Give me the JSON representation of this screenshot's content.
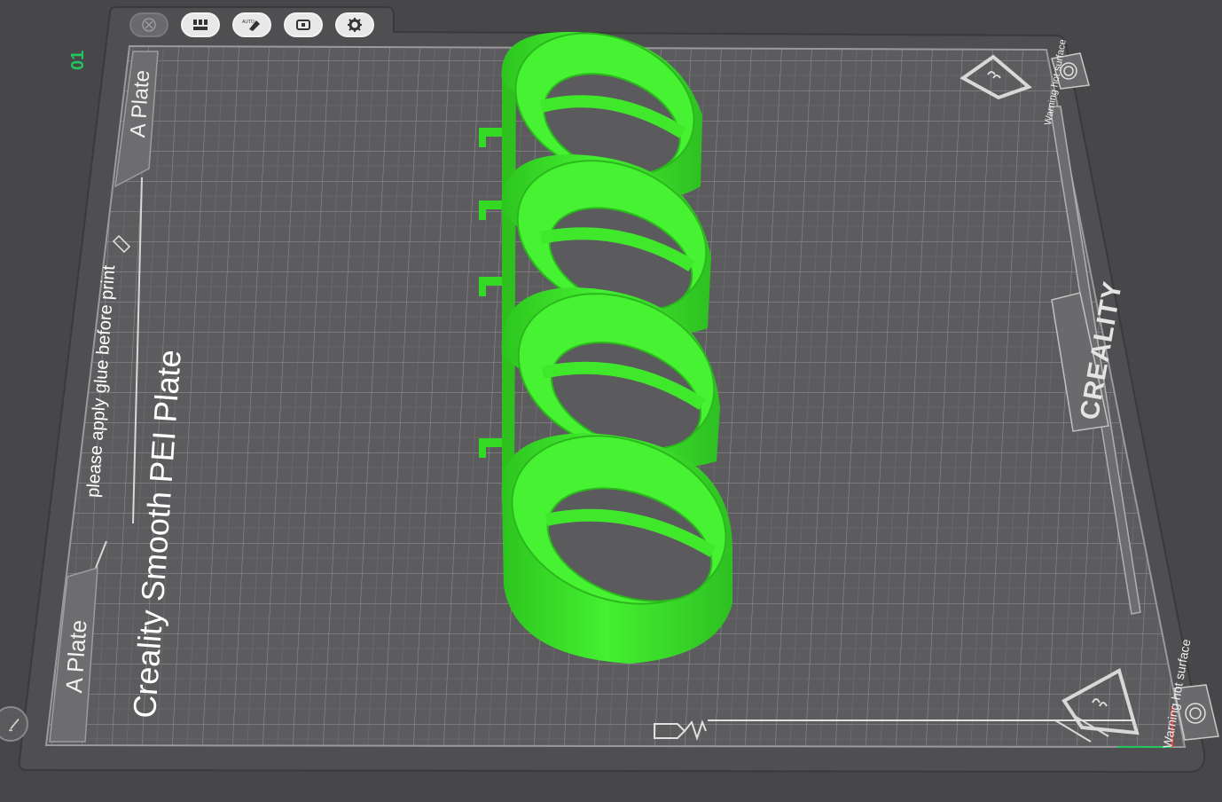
{
  "toolbar": {
    "buttons": [
      {
        "name": "close-plate-button",
        "icon": "close-icon",
        "state": "disabled"
      },
      {
        "name": "arrange-button",
        "icon": "arrange-icon",
        "state": "enabled"
      },
      {
        "name": "auto-orient-button",
        "icon": "auto-orient-icon",
        "label": "AUTO",
        "state": "enabled"
      },
      {
        "name": "lock-plate-button",
        "icon": "lock-icon",
        "state": "enabled"
      },
      {
        "name": "plate-settings-button",
        "icon": "gear-icon",
        "state": "enabled"
      }
    ]
  },
  "plate": {
    "index": "01",
    "bed_name": "Creality Smooth PEI Plate",
    "glue_hint": "please apply glue before print",
    "side_label_top": "A Plate",
    "side_label_bottom": "A Plate",
    "brand": "CREALITY",
    "warning_top": "Warning hot surface",
    "warning_bottom": "Warning hot surface"
  },
  "model": {
    "color": "#39e52b",
    "ring_count": 4
  },
  "colors": {
    "background": "#474749",
    "bed": "#5c5c5e",
    "grid_line": "#8d8d8f",
    "accent": "#22c55e"
  }
}
